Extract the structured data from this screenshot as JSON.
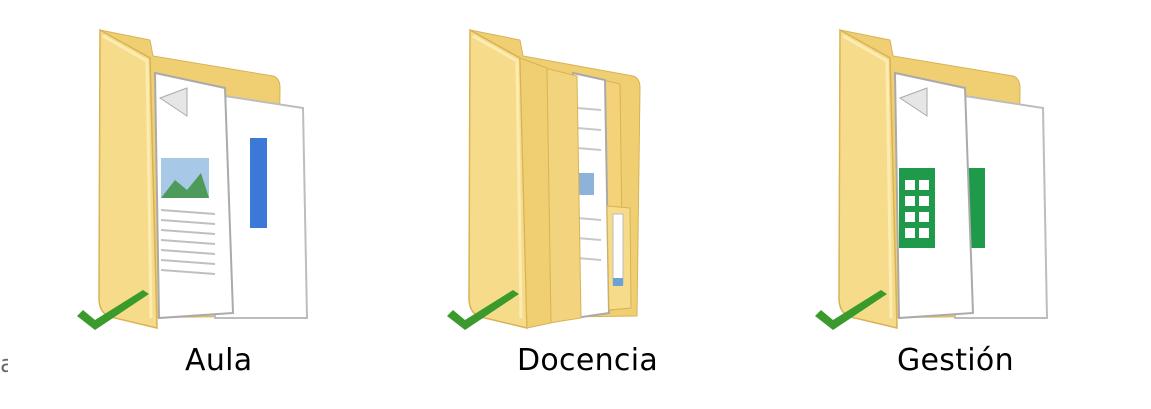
{
  "explorer": {
    "edge_fragment": "a",
    "folders": [
      {
        "name": "Aula",
        "icon": "folder-docs-icon",
        "sync_status": "synced",
        "preview": "image-and-doc"
      },
      {
        "name": "Docencia",
        "icon": "folder-docs-icon",
        "sync_status": "synced",
        "preview": "text-pages"
      },
      {
        "name": "Gestión",
        "icon": "folder-sheets-icon",
        "sync_status": "synced",
        "preview": "spreadsheet"
      }
    ],
    "colors": {
      "folder_front": "#f6dc8a",
      "folder_back": "#eccb6a",
      "check_green": "#3a9a2c",
      "doc_blue": "#3b78d8",
      "sheet_green": "#1e9a4a"
    }
  }
}
